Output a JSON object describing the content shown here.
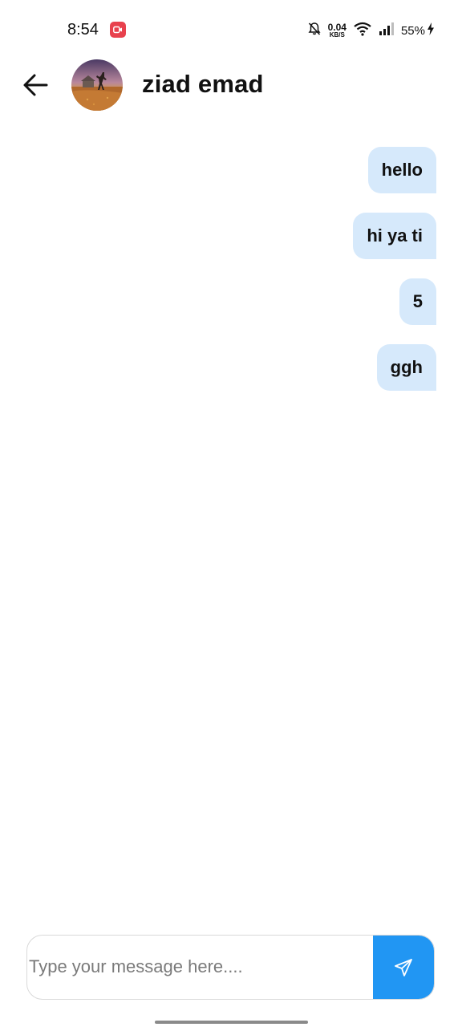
{
  "status_bar": {
    "time": "8:54",
    "net_speed_value": "0.04",
    "net_speed_unit": "KB/S",
    "battery": "55%",
    "icons": [
      "screen-record-icon",
      "bell-muted-icon",
      "wifi-icon",
      "signal-icon",
      "charging-icon"
    ]
  },
  "header": {
    "back_icon": "arrow-left-icon",
    "contact_name": "ziad emad"
  },
  "messages": [
    {
      "text": "hello",
      "direction": "outgoing"
    },
    {
      "text": "hi ya ti",
      "direction": "outgoing"
    },
    {
      "text": "5",
      "direction": "outgoing"
    },
    {
      "text": "ggh",
      "direction": "outgoing"
    }
  ],
  "composer": {
    "placeholder": "Type your message here....",
    "value": "",
    "send_icon": "send-icon"
  },
  "colors": {
    "accent": "#2196f3",
    "bubble": "#d6e9fb",
    "record_badge": "#e8414d"
  }
}
